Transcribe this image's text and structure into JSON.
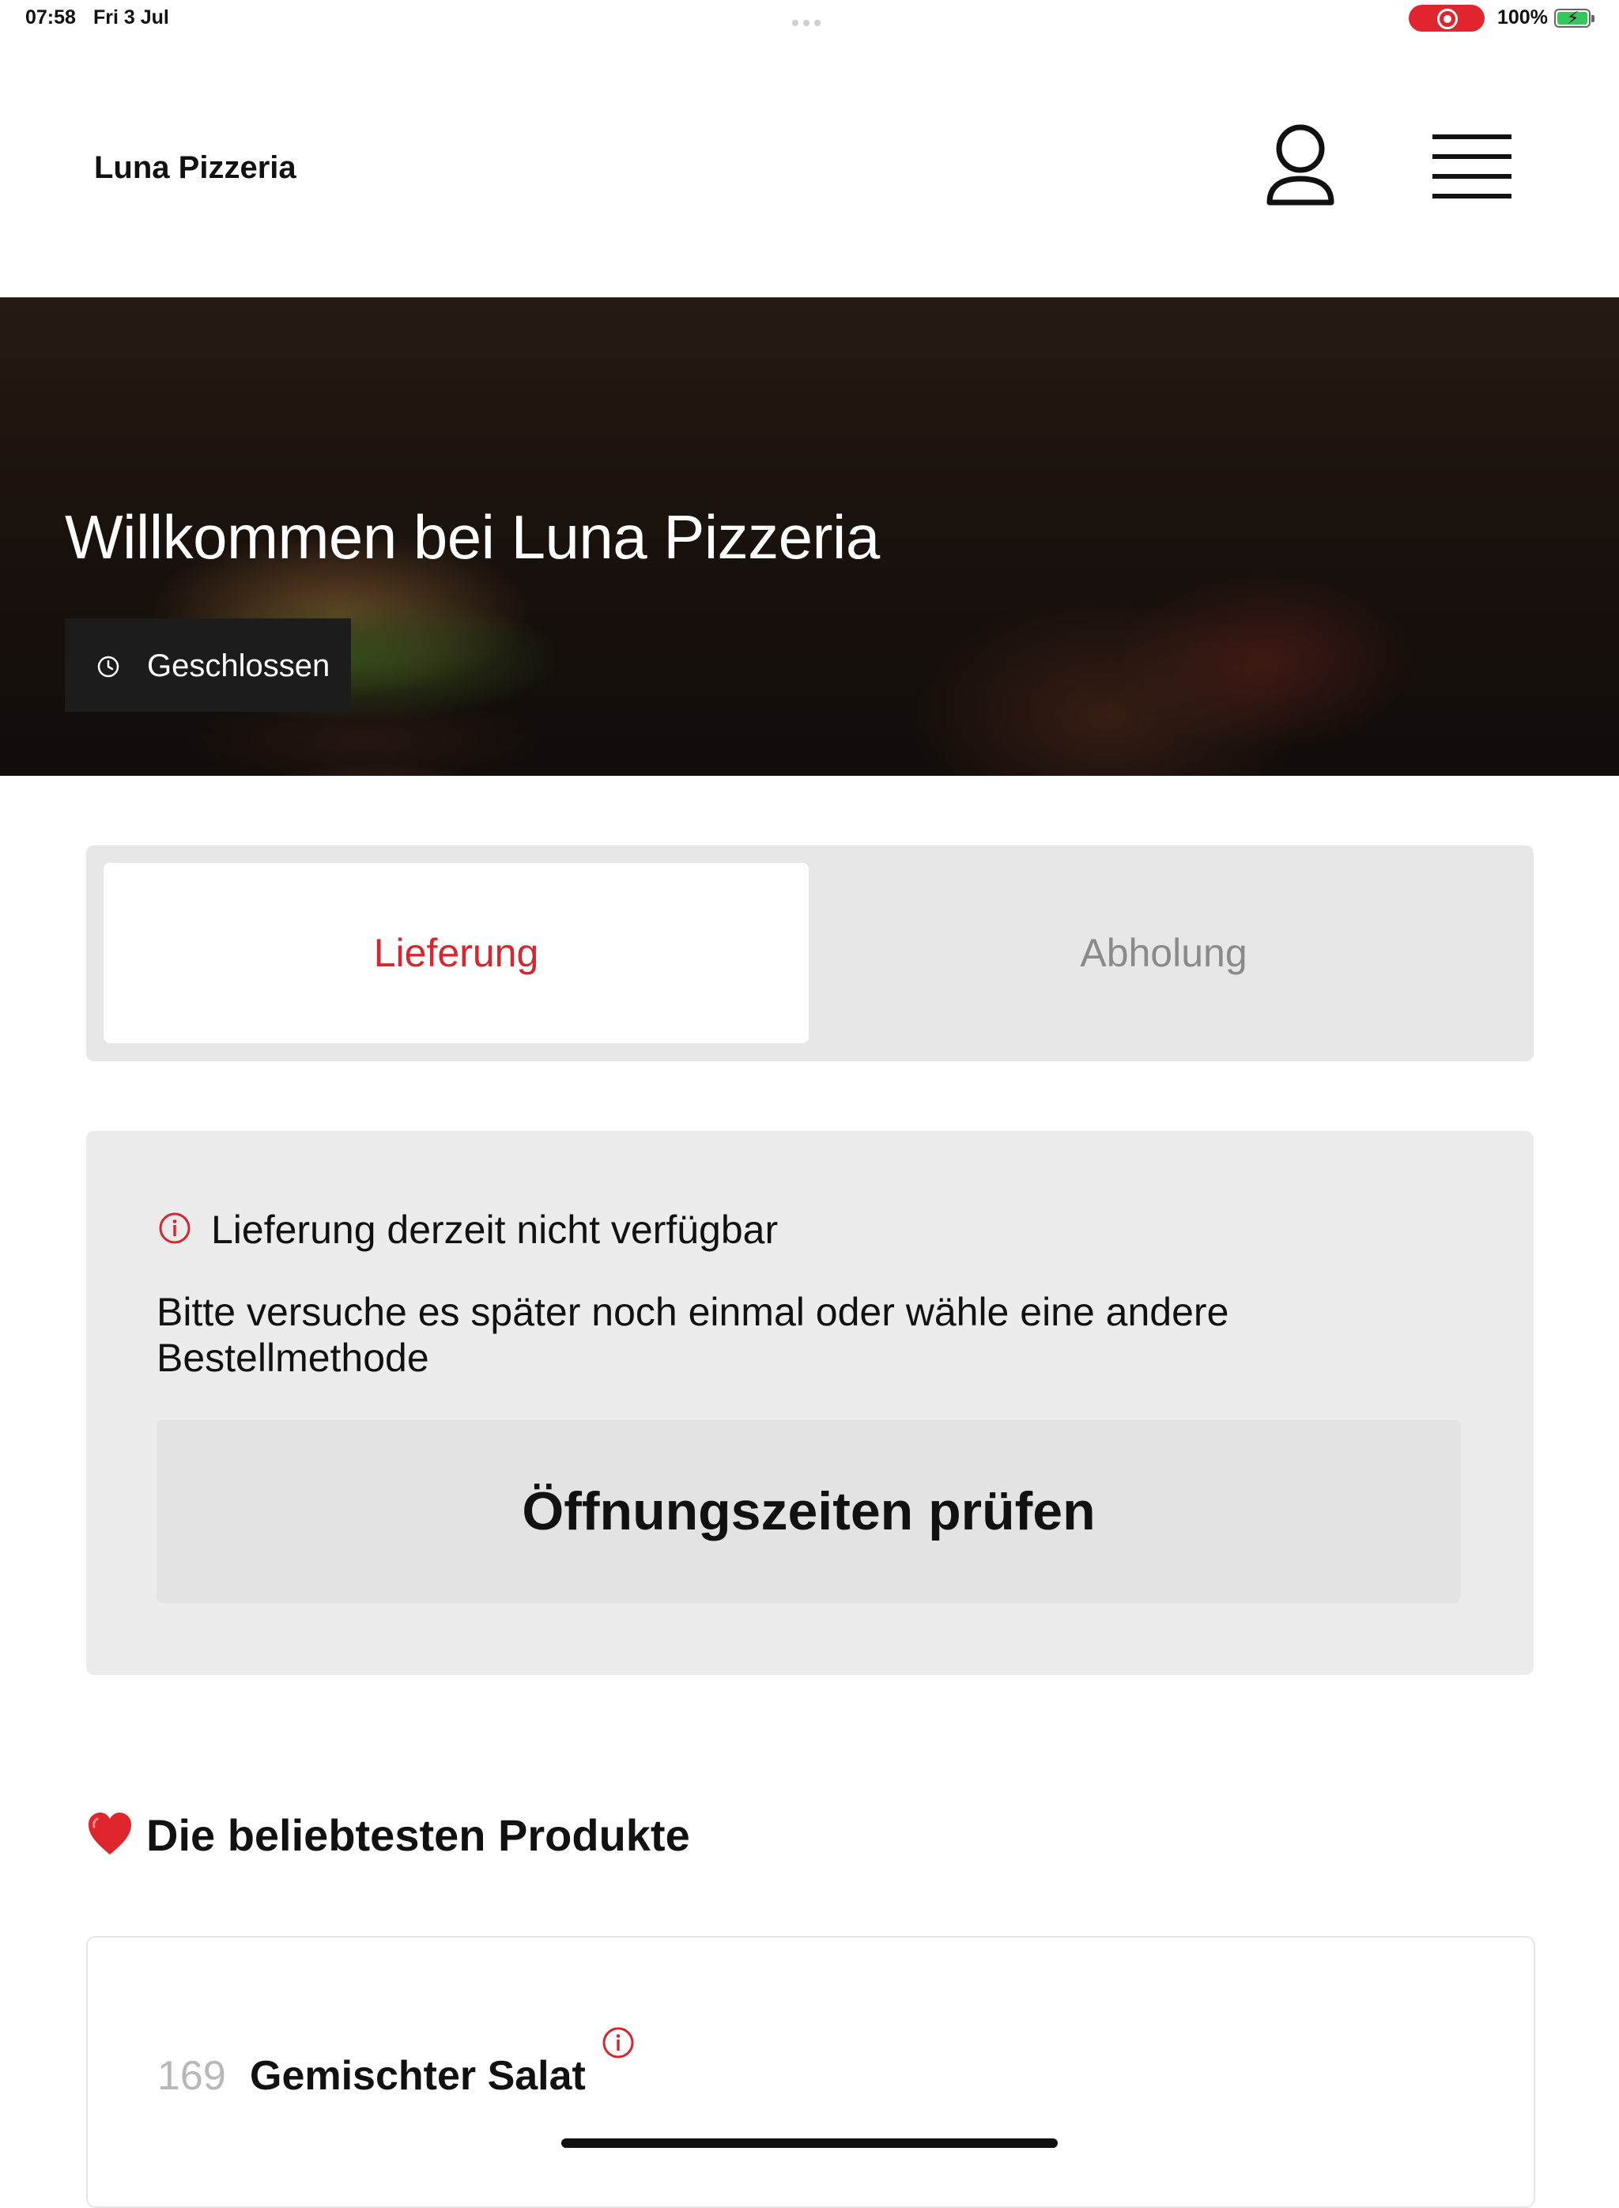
{
  "status_bar": {
    "time": "07:58",
    "date": "Fri 3 Jul",
    "battery": "100%",
    "record_color": "#e0252f"
  },
  "header": {
    "brand": "Luna Pizzeria",
    "icons": [
      "user-icon",
      "menu-icon"
    ]
  },
  "hero": {
    "title": "Willkommen bei Luna Pizzeria",
    "status_badge": "Geschlossen",
    "status_icon": "clock-icon"
  },
  "tabs": {
    "items": [
      {
        "label": "Lieferung",
        "active": true
      },
      {
        "label": "Abholung",
        "active": false
      }
    ],
    "accent_color": "#d8262e"
  },
  "notice": {
    "icon": "info-icon",
    "title": "Lieferung derzeit nicht verfügbar",
    "text": "Bitte versuche es später noch einmal oder wähle eine andere Bestellmethode",
    "button_label": "Öffnungszeiten prüfen"
  },
  "popular": {
    "title": "Die beliebtesten Produkte",
    "icon": "heart-icon",
    "products": [
      {
        "number": "169",
        "name": "Gemischter Salat",
        "icon": "info-icon"
      }
    ]
  }
}
